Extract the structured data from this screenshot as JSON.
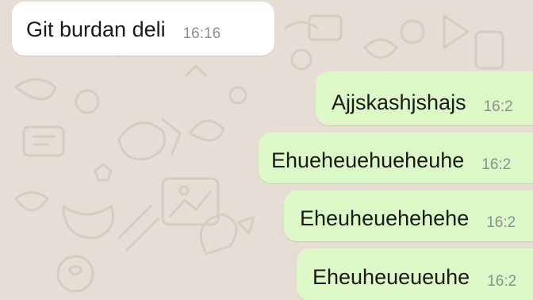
{
  "messages": [
    {
      "direction": "incoming",
      "text": "Git burdan deli",
      "time": "16:16"
    },
    {
      "direction": "outgoing",
      "text": "Ajjskashjshajs",
      "time": "16:2"
    },
    {
      "direction": "outgoing",
      "text": "Ehueheuehueheuhe",
      "time": "16:2"
    },
    {
      "direction": "outgoing",
      "text": "Eheuheuehehehe",
      "time": "16:2"
    },
    {
      "direction": "outgoing",
      "text": "Eheuheueueuhe",
      "time": "16:2"
    }
  ],
  "colors": {
    "wallpaper": "#e6ddd4",
    "incoming_bubble": "#ffffff",
    "outgoing_bubble": "#dcf8c6",
    "timestamp": "#8a8f93"
  }
}
